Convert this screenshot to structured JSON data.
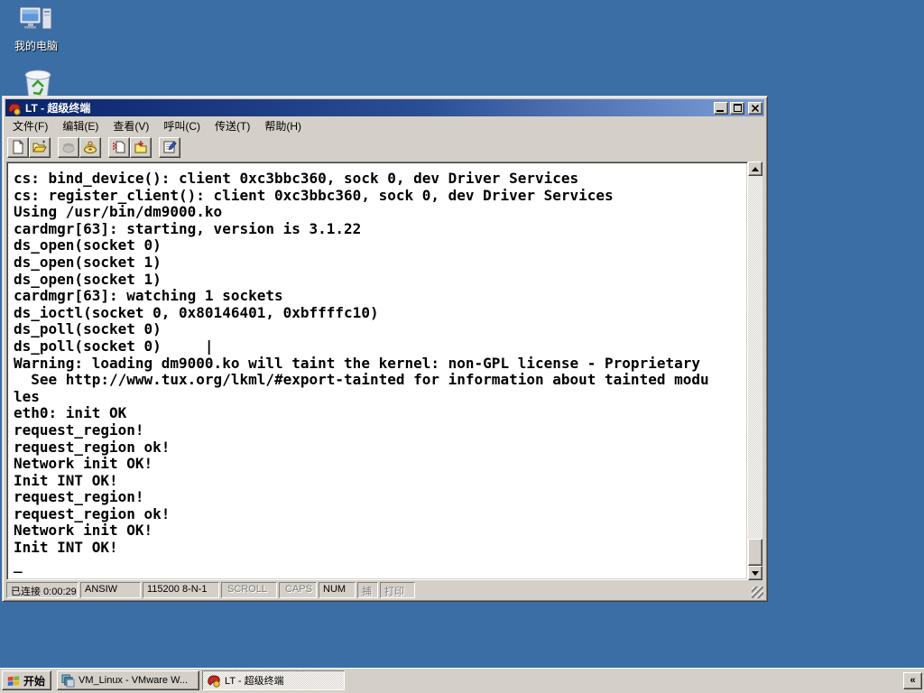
{
  "desktop": {
    "bg_color": "#3A6EA5",
    "my_computer_label": "我的电脑"
  },
  "window": {
    "title": "LT - 超级终端",
    "menu": [
      "文件(F)",
      "编辑(E)",
      "查看(V)",
      "呼叫(C)",
      "传送(T)",
      "帮助(H)"
    ],
    "toolbar_icons": [
      "new-connection",
      "open",
      "call",
      "disconnect",
      "send-file",
      "receive-file",
      "properties"
    ],
    "terminal": {
      "lines": [
        "cs: bind_device(): client 0xc3bbc360, sock 0, dev Driver Services",
        "cs: register_client(): client 0xc3bbc360, sock 0, dev Driver Services",
        "Using /usr/bin/dm9000.ko",
        "cardmgr[63]: starting, version is 3.1.22",
        "ds_open(socket 0)",
        "ds_open(socket 1)",
        "ds_open(socket 1)",
        "cardmgr[63]: watching 1 sockets",
        "ds_ioctl(socket 0, 0x80146401, 0xbffffc10)",
        "ds_poll(socket 0)",
        "ds_poll(socket 0)     |",
        "Warning: loading dm9000.ko will taint the kernel: non-GPL license - Proprietary",
        "  See http://www.tux.org/lkml/#export-tainted for information about tainted modu",
        "les",
        "eth0: init OK",
        "request_region!",
        "request_region ok!",
        "Network init OK!",
        "Init INT OK!",
        "request_region!",
        "request_region ok!",
        "Network init OK!",
        "Init INT OK!",
        "_"
      ]
    },
    "status": [
      {
        "label": "已连接 0:00:29",
        "state": "normal"
      },
      {
        "label": "ANSIW",
        "state": "normal"
      },
      {
        "label": "115200 8-N-1",
        "state": "normal"
      },
      {
        "label": "SCROLL",
        "state": "disabled"
      },
      {
        "label": "CAPS",
        "state": "disabled"
      },
      {
        "label": "NUM",
        "state": "normal"
      },
      {
        "label": "捕",
        "state": "disabled"
      },
      {
        "label": "打印",
        "state": "disabled"
      }
    ]
  },
  "taskbar": {
    "start_label": "开始",
    "tasks": [
      {
        "label": "VM_Linux - VMware W...",
        "active": false
      },
      {
        "label": "LT - 超级终端",
        "active": true
      }
    ],
    "collapse_label": "«"
  },
  "colors": {
    "desktop_bg": "#3A6EA5",
    "chrome": "#D4D0C8",
    "titlebar_start": "#0A246A",
    "titlebar_end": "#7B9FD8",
    "terminal_bg": "#FFFFFF",
    "terminal_text": "#000000"
  }
}
